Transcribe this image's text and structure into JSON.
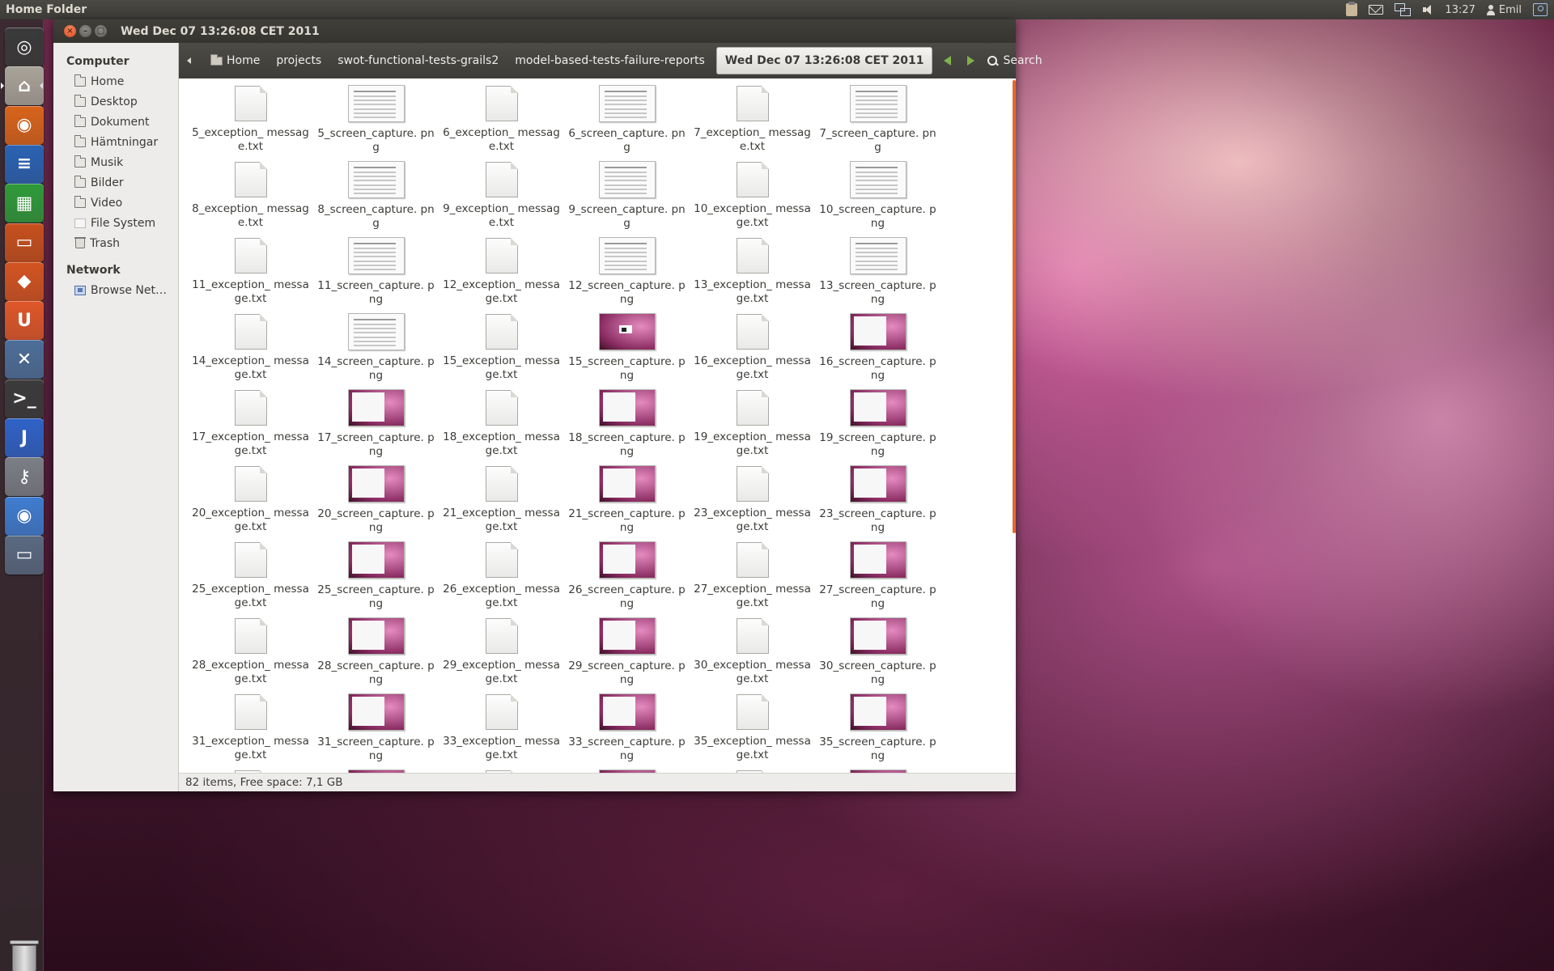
{
  "top_panel": {
    "app_title": "Home Folder",
    "clock": "13:27",
    "user": "Emil",
    "indicators": [
      "clipboard-icon",
      "mail-icon",
      "network-icon",
      "sound-icon",
      "session-icon"
    ]
  },
  "launcher": {
    "items": [
      {
        "name": "dash-home-button",
        "label": "Dash",
        "color": "#3a3a3a"
      },
      {
        "name": "launcher-home-folder",
        "label": "Home Folder",
        "color": "#a9a49a"
      },
      {
        "name": "launcher-firefox",
        "label": "Firefox",
        "color": "#d9641b"
      },
      {
        "name": "launcher-writer",
        "label": "Writer",
        "color": "#2a63b4"
      },
      {
        "name": "launcher-calc",
        "label": "Calc",
        "color": "#2f9b3a"
      },
      {
        "name": "launcher-impress",
        "label": "Impress",
        "color": "#c7501e"
      },
      {
        "name": "launcher-software-center",
        "label": "Software Center",
        "color": "#d45421"
      },
      {
        "name": "launcher-ubuntu-one",
        "label": "Ubuntu One",
        "color": "#e0572a"
      },
      {
        "name": "launcher-system-settings",
        "label": "System Settings",
        "color": "#4d6f9a"
      },
      {
        "name": "launcher-terminal",
        "label": "Terminal",
        "color": "#3b3b3b"
      },
      {
        "name": "launcher-intellij",
        "label": "IntelliJ IDEA",
        "color": "#2f63c8"
      },
      {
        "name": "launcher-passwords",
        "label": "Passwords and Keys",
        "color": "#7b7f86"
      },
      {
        "name": "launcher-chrome",
        "label": "Chrome",
        "color": "#3f7dd1"
      },
      {
        "name": "launcher-window",
        "label": "Window",
        "color": "#5a6a82"
      }
    ],
    "trash_label": "Trash"
  },
  "window": {
    "title": "Wed Dec 07 13:26:08 CET 2011",
    "buttons": {
      "close": "×",
      "minimize": "–",
      "maximize": "□"
    }
  },
  "pathbar": {
    "crumbs": [
      "Home",
      "projects",
      "swot-functional-tests-grails2",
      "model-based-tests-failure-reports"
    ],
    "active": "Wed Dec 07 13:26:08 CET 2011",
    "search_label": "Search"
  },
  "sidebar": {
    "computer_heading": "Computer",
    "computer_items": [
      {
        "label": "Home",
        "icon": "folder"
      },
      {
        "label": "Desktop",
        "icon": "folder"
      },
      {
        "label": "Dokument",
        "icon": "folder"
      },
      {
        "label": "Hämtningar",
        "icon": "folder"
      },
      {
        "label": "Musik",
        "icon": "folder"
      },
      {
        "label": "Bilder",
        "icon": "folder"
      },
      {
        "label": "Video",
        "icon": "folder"
      },
      {
        "label": "File System",
        "icon": "disk"
      },
      {
        "label": "Trash",
        "icon": "trash"
      }
    ],
    "network_heading": "Network",
    "network_items": [
      {
        "label": "Browse Net…",
        "icon": "net"
      }
    ]
  },
  "files": [
    {
      "name": "5_exception_ message.txt",
      "type": "txt"
    },
    {
      "name": "5_screen_capture. png",
      "type": "png",
      "thumb": "doc"
    },
    {
      "name": "6_exception_ message.txt",
      "type": "txt"
    },
    {
      "name": "6_screen_capture. png",
      "type": "png",
      "thumb": "doc"
    },
    {
      "name": "7_exception_ message.txt",
      "type": "txt"
    },
    {
      "name": "7_screen_capture. png",
      "type": "png",
      "thumb": "doc"
    },
    {
      "name": "8_exception_ message.txt",
      "type": "txt"
    },
    {
      "name": "8_screen_capture. png",
      "type": "png",
      "thumb": "doc"
    },
    {
      "name": "9_exception_ message.txt",
      "type": "txt"
    },
    {
      "name": "9_screen_capture. png",
      "type": "png",
      "thumb": "doc"
    },
    {
      "name": "10_exception_ message.txt",
      "type": "txt"
    },
    {
      "name": "10_screen_capture. png",
      "type": "png",
      "thumb": "doc"
    },
    {
      "name": "11_exception_ message.txt",
      "type": "txt"
    },
    {
      "name": "11_screen_capture. png",
      "type": "png",
      "thumb": "doc"
    },
    {
      "name": "12_exception_ message.txt",
      "type": "txt"
    },
    {
      "name": "12_screen_capture. png",
      "type": "png",
      "thumb": "doc"
    },
    {
      "name": "13_exception_ message.txt",
      "type": "txt"
    },
    {
      "name": "13_screen_capture. png",
      "type": "png",
      "thumb": "doc"
    },
    {
      "name": "14_exception_ message.txt",
      "type": "txt"
    },
    {
      "name": "14_screen_capture. png",
      "type": "png",
      "thumb": "doc"
    },
    {
      "name": "15_exception_ message.txt",
      "type": "txt"
    },
    {
      "name": "15_screen_capture. png",
      "type": "png",
      "thumb": "desk small"
    },
    {
      "name": "16_exception_ message.txt",
      "type": "txt"
    },
    {
      "name": "16_screen_capture. png",
      "type": "png",
      "thumb": "desk"
    },
    {
      "name": "17_exception_ message.txt",
      "type": "txt"
    },
    {
      "name": "17_screen_capture. png",
      "type": "png",
      "thumb": "desk"
    },
    {
      "name": "18_exception_ message.txt",
      "type": "txt"
    },
    {
      "name": "18_screen_capture. png",
      "type": "png",
      "thumb": "desk"
    },
    {
      "name": "19_exception_ message.txt",
      "type": "txt"
    },
    {
      "name": "19_screen_capture. png",
      "type": "png",
      "thumb": "desk"
    },
    {
      "name": "20_exception_ message.txt",
      "type": "txt"
    },
    {
      "name": "20_screen_capture. png",
      "type": "png",
      "thumb": "desk"
    },
    {
      "name": "21_exception_ message.txt",
      "type": "txt"
    },
    {
      "name": "21_screen_capture. png",
      "type": "png",
      "thumb": "desk"
    },
    {
      "name": "23_exception_ message.txt",
      "type": "txt"
    },
    {
      "name": "23_screen_capture. png",
      "type": "png",
      "thumb": "desk"
    },
    {
      "name": "25_exception_ message.txt",
      "type": "txt"
    },
    {
      "name": "25_screen_capture. png",
      "type": "png",
      "thumb": "desk"
    },
    {
      "name": "26_exception_ message.txt",
      "type": "txt"
    },
    {
      "name": "26_screen_capture. png",
      "type": "png",
      "thumb": "desk"
    },
    {
      "name": "27_exception_ message.txt",
      "type": "txt"
    },
    {
      "name": "27_screen_capture. png",
      "type": "png",
      "thumb": "desk"
    },
    {
      "name": "28_exception_ message.txt",
      "type": "txt"
    },
    {
      "name": "28_screen_capture. png",
      "type": "png",
      "thumb": "desk"
    },
    {
      "name": "29_exception_ message.txt",
      "type": "txt"
    },
    {
      "name": "29_screen_capture. png",
      "type": "png",
      "thumb": "desk"
    },
    {
      "name": "30_exception_ message.txt",
      "type": "txt"
    },
    {
      "name": "30_screen_capture. png",
      "type": "png",
      "thumb": "desk"
    },
    {
      "name": "31_exception_ message.txt",
      "type": "txt"
    },
    {
      "name": "31_screen_capture. png",
      "type": "png",
      "thumb": "desk"
    },
    {
      "name": "33_exception_ message.txt",
      "type": "txt"
    },
    {
      "name": "33_screen_capture. png",
      "type": "png",
      "thumb": "desk"
    },
    {
      "name": "35_exception_ message.txt",
      "type": "txt"
    },
    {
      "name": "35_screen_capture. png",
      "type": "png",
      "thumb": "desk"
    },
    {
      "name": "",
      "type": "txt"
    },
    {
      "name": "",
      "type": "png",
      "thumb": "desk"
    },
    {
      "name": "",
      "type": "txt"
    },
    {
      "name": "",
      "type": "png",
      "thumb": "desk"
    },
    {
      "name": "",
      "type": "txt"
    },
    {
      "name": "",
      "type": "png",
      "thumb": "desk"
    }
  ],
  "status": "82 items, Free space: 7,1 GB",
  "colors": {
    "accent": "#e36a2c",
    "panel": "#3c3b37",
    "close_button": "#d8481b"
  }
}
